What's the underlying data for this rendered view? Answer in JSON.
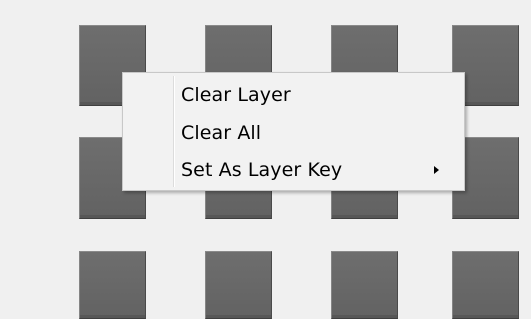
{
  "pads": {
    "rows": 3,
    "columns": 4
  },
  "context_menu": {
    "items": [
      {
        "label": "Clear Layer",
        "has_submenu": false
      },
      {
        "label": "Clear All",
        "has_submenu": false
      },
      {
        "label": "Set As Layer Key",
        "has_submenu": true,
        "submenu_icon": "chevron-right-icon"
      }
    ]
  },
  "colors": {
    "background": "#f0f0f0",
    "pad": "#676767",
    "menu_background": "#f2f2f2",
    "menu_text": "#000000"
  }
}
